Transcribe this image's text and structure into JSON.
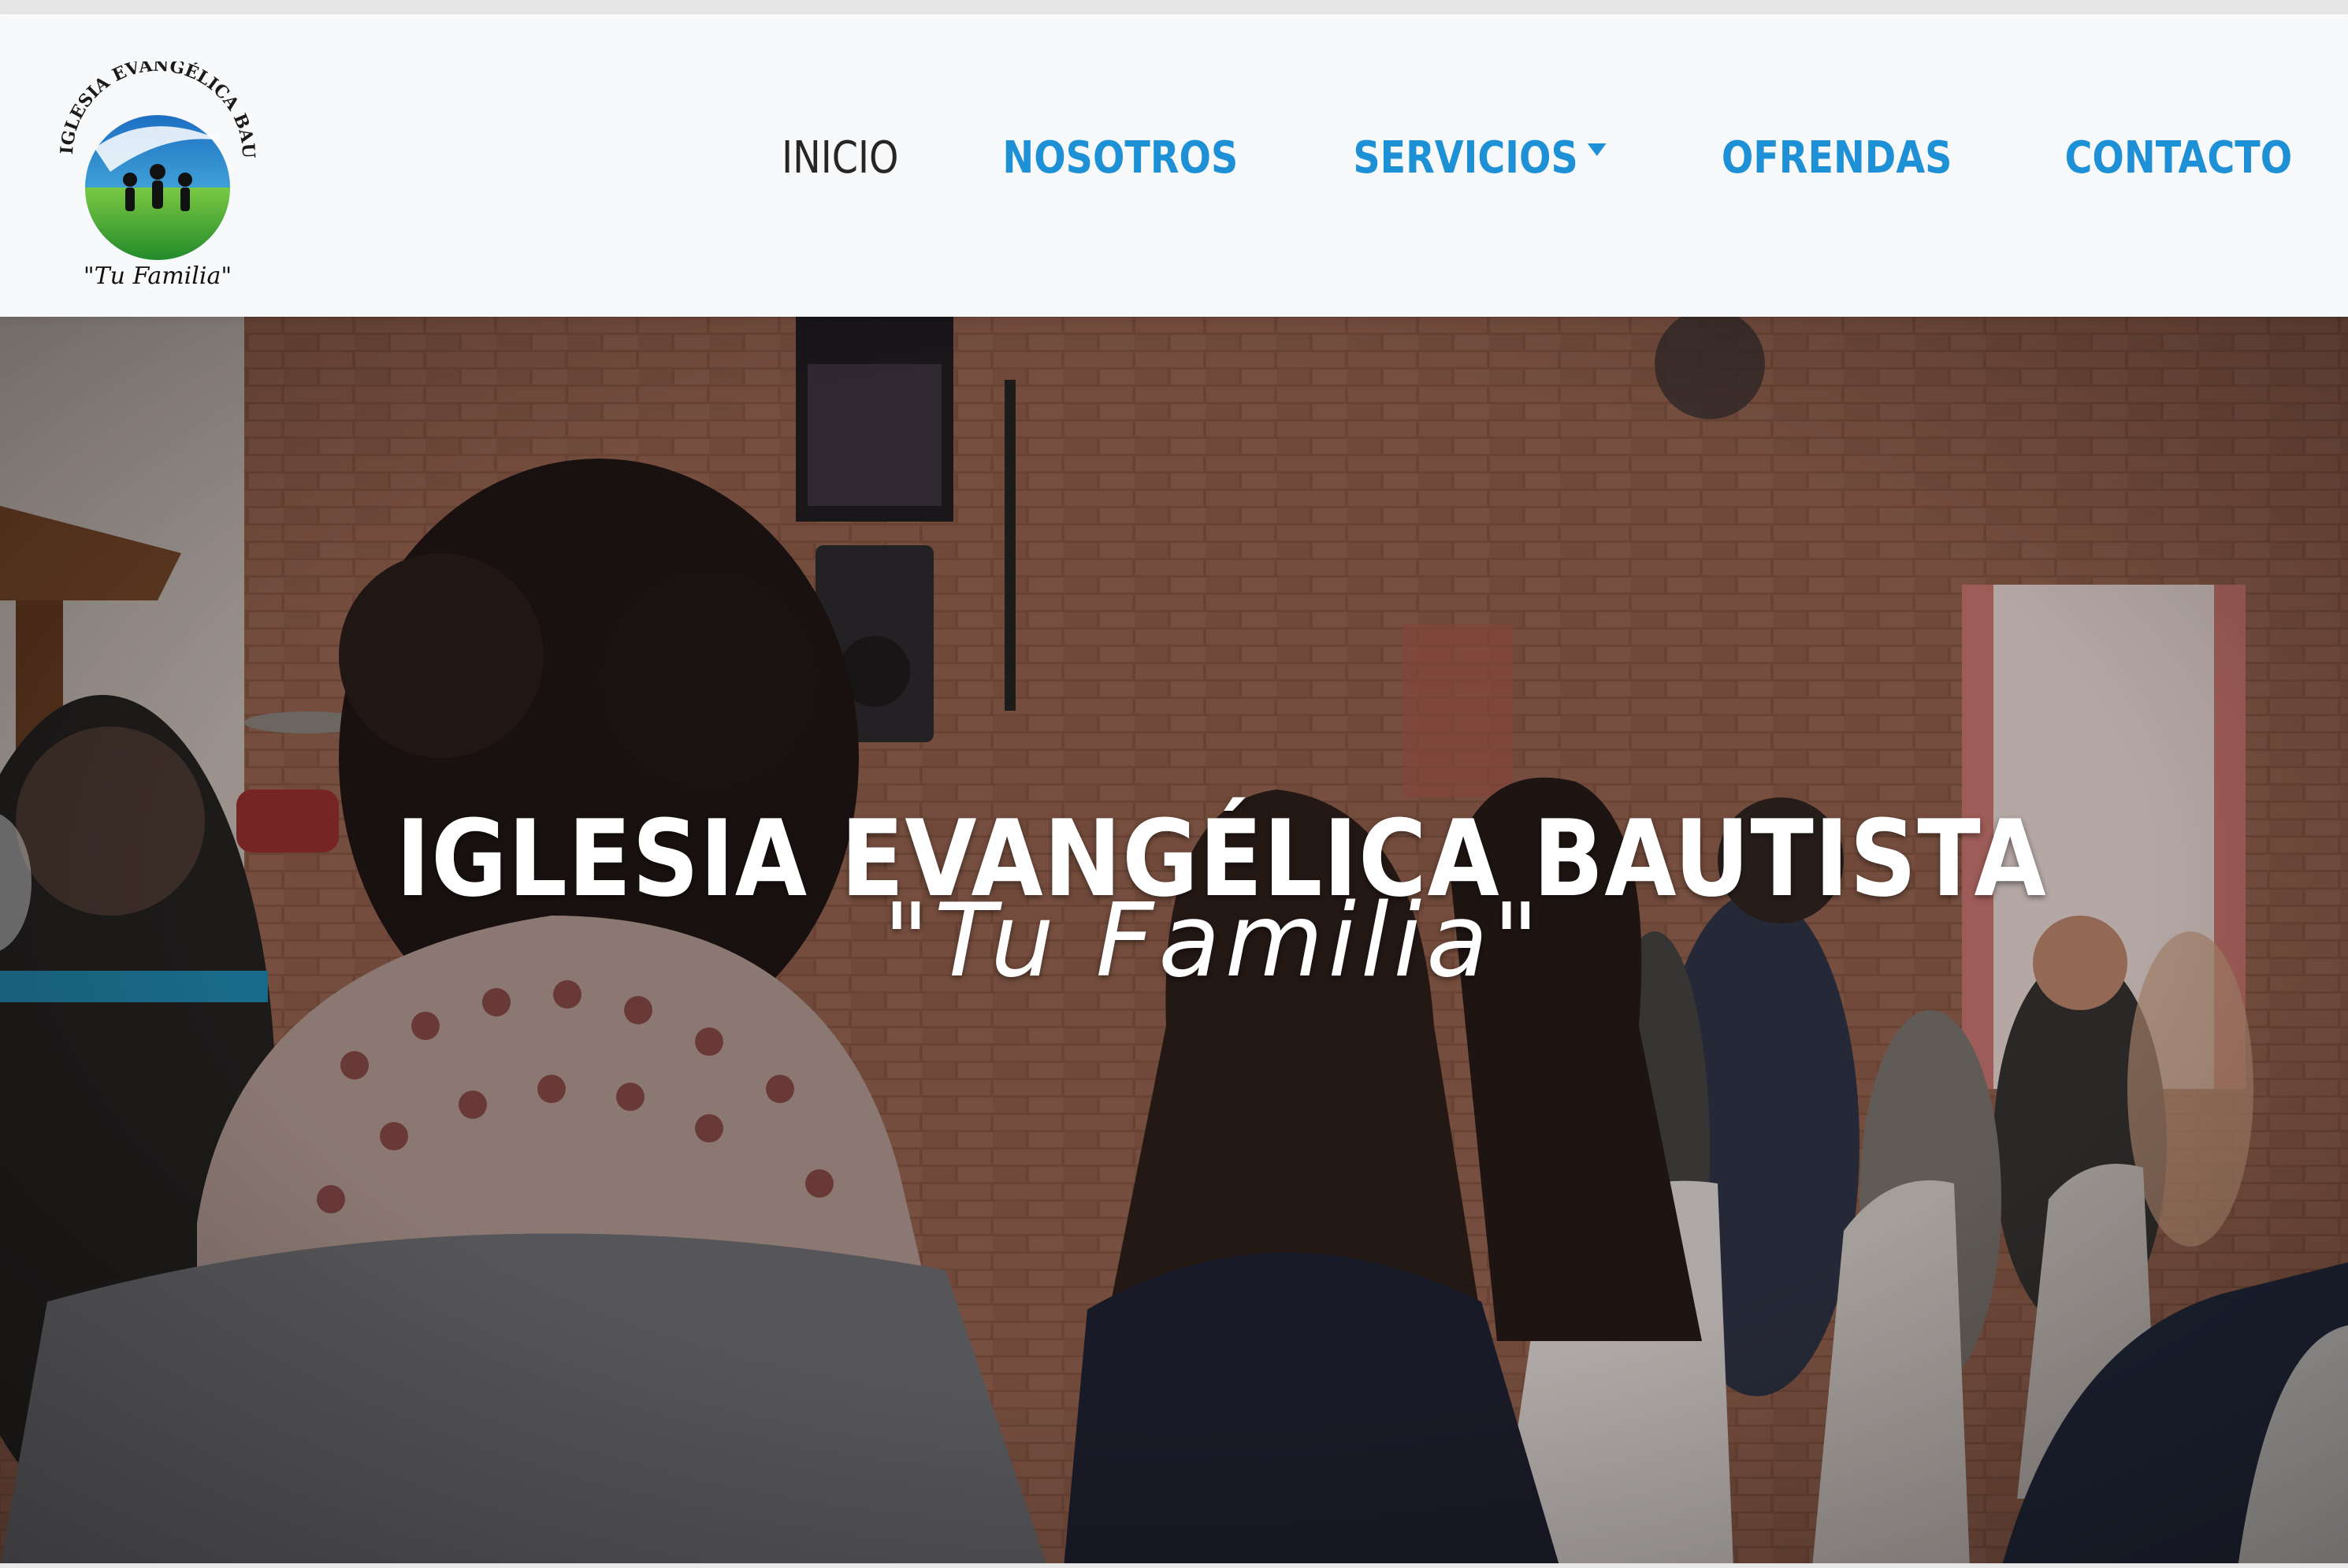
{
  "brand": {
    "logo_arc_text": "IGLESIA EVANGÉLICA BAUTISTA",
    "logo_tagline": "\"Tu Familia\"",
    "colors": {
      "blue": "#1e6fc4",
      "green": "#3aa832",
      "cyan": "#5fd0e6"
    }
  },
  "nav": {
    "items": [
      {
        "label": "INICIO",
        "active": true
      },
      {
        "label": "NOSOTROS",
        "active": false
      },
      {
        "label": "SERVICIOS",
        "active": false,
        "has_dropdown": true
      },
      {
        "label": "OFRENDAS",
        "active": false
      },
      {
        "label": "CONTACTO",
        "active": false
      }
    ],
    "link_color": "#1e90d6",
    "active_color": "#262626"
  },
  "hero": {
    "title": "IGLESIA EVANGÉLICA BAUTISTA",
    "subtitle": "\"Tu Familia\""
  }
}
